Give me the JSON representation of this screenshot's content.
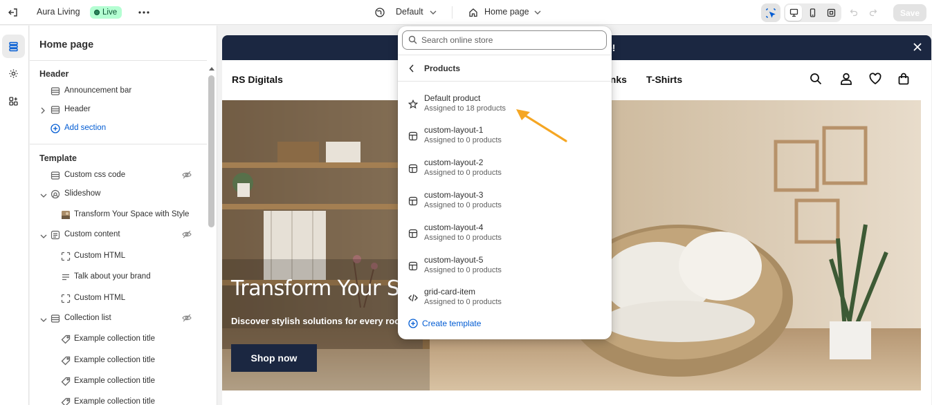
{
  "topbar": {
    "store_name": "Aura Living",
    "status_badge": "Live",
    "theme_selector": "Default",
    "page_selector": "Home page",
    "save_label": "Save"
  },
  "sidebar": {
    "title": "Home page",
    "header_group": {
      "heading": "Header",
      "items": [
        {
          "label": "Announcement bar"
        },
        {
          "label": "Header"
        }
      ],
      "add_section": "Add section"
    },
    "template_group": {
      "heading": "Template",
      "items": [
        {
          "label": "Custom css code"
        },
        {
          "label": "Slideshow"
        },
        {
          "label": "Transform Your Space with Style"
        },
        {
          "label": "Custom content"
        },
        {
          "label": "Custom HTML"
        },
        {
          "label": "Talk about your brand"
        },
        {
          "label": "Custom HTML"
        },
        {
          "label": "Collection list"
        },
        {
          "label": "Example collection title"
        },
        {
          "label": "Example collection title"
        },
        {
          "label": "Example collection title"
        },
        {
          "label": "Example collection title"
        }
      ]
    }
  },
  "preview": {
    "announcement_text": "e!",
    "brand": "RS Digitals",
    "nav": [
      "anks",
      "T-Shirts"
    ],
    "hero": {
      "title": "Transform Your Spa",
      "subtitle": "Discover stylish solutions for every room",
      "button": "Shop now"
    }
  },
  "dropdown": {
    "search_placeholder": "Search online store",
    "back_label": "Products",
    "items": [
      {
        "name": "Default product",
        "sub": "Assigned to 18 products",
        "icon": "star-icon"
      },
      {
        "name": "custom-layout-1",
        "sub": "Assigned to 0 products",
        "icon": "layout-icon"
      },
      {
        "name": "custom-layout-2",
        "sub": "Assigned to 0 products",
        "icon": "layout-icon"
      },
      {
        "name": "custom-layout-3",
        "sub": "Assigned to 0 products",
        "icon": "layout-icon"
      },
      {
        "name": "custom-layout-4",
        "sub": "Assigned to 0 products",
        "icon": "layout-icon"
      },
      {
        "name": "custom-layout-5",
        "sub": "Assigned to 0 products",
        "icon": "layout-icon"
      },
      {
        "name": "grid-card-item",
        "sub": "Assigned to 0 products",
        "icon": "code-icon"
      }
    ],
    "create_label": "Create template"
  },
  "colors": {
    "accent_blue": "#005bd3",
    "announcement_bg": "#1b2741",
    "annotation_arrow": "#f5a623",
    "live_badge_bg": "#b4fed2"
  }
}
